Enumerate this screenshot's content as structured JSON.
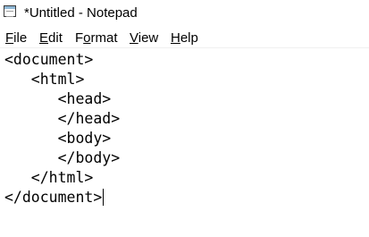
{
  "window": {
    "title": "*Untitled - Notepad",
    "icon": "notepad-icon"
  },
  "menu": {
    "file": {
      "mnemonic": "F",
      "rest": "ile"
    },
    "edit": {
      "mnemonic": "E",
      "rest": "dit"
    },
    "format": {
      "mnemonic": "",
      "rest": "Format",
      "pre": "F",
      "mn": "o",
      "post": "rmat"
    },
    "view": {
      "mnemonic": "V",
      "rest": "iew"
    },
    "help": {
      "mnemonic": "H",
      "rest": "elp"
    }
  },
  "editor": {
    "content": "<document>\n   <html>\n      <head>\n      </head>\n      <body>\n      </body>\n   </html>\n</document>"
  }
}
